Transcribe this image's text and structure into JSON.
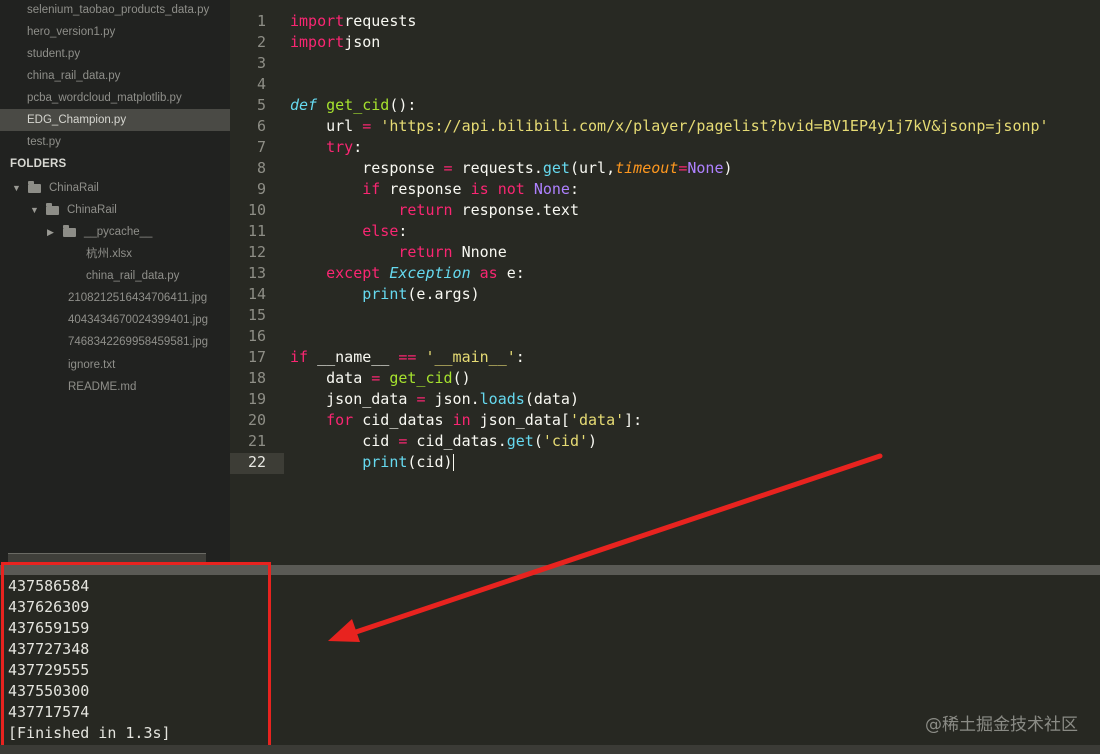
{
  "sidebar": {
    "open_files": [
      "selenium_taobao_products_data.py",
      "hero_version1.py",
      "student.py",
      "china_rail_data.py",
      "pcba_wordcloud_matplotlib.py",
      "EDG_Champion.py",
      "test.py"
    ],
    "active_open_file": "EDG_Champion.py",
    "folders_label": "FOLDERS",
    "tree": [
      {
        "label": "ChinaRail",
        "kind": "folder",
        "expanded": true
      },
      {
        "label": "ChinaRail",
        "kind": "folder",
        "expanded": true
      },
      {
        "label": "__pycache__",
        "kind": "folder",
        "expanded": false
      },
      {
        "label": "杭州.xlsx",
        "kind": "file"
      },
      {
        "label": "china_rail_data.py",
        "kind": "file"
      },
      {
        "label": "2108212516434706411.jpg",
        "kind": "file"
      },
      {
        "label": "4043434670024399401.jpg",
        "kind": "file"
      },
      {
        "label": "7468342269958459581.jpg",
        "kind": "file"
      },
      {
        "label": "ignore.txt",
        "kind": "file"
      },
      {
        "label": "README.md",
        "kind": "file"
      }
    ]
  },
  "editor": {
    "language": "python",
    "current_line": 22,
    "line_numbers": [
      "1",
      "2",
      "3",
      "4",
      "5",
      "6",
      "7",
      "8",
      "9",
      "10",
      "11",
      "12",
      "13",
      "14",
      "15",
      "16",
      "17",
      "18",
      "19",
      "20",
      "21",
      "22"
    ],
    "lines": [
      [
        [
          "kw",
          "import"
        ],
        [
          "",
          "requests"
        ]
      ],
      [
        [
          "kw",
          "import"
        ],
        [
          "",
          "json"
        ]
      ],
      [],
      [],
      [
        [
          "df",
          "def"
        ],
        [
          "",
          " "
        ],
        [
          "fn",
          "get_cid"
        ],
        [
          "",
          "():"
        ]
      ],
      [
        [
          "",
          "    url "
        ],
        [
          "kw",
          "="
        ],
        [
          "",
          " "
        ],
        [
          "st",
          "'https://api.bilibili.com/x/player/pagelist?bvid=BV1EP4y1j7kV&jsonp=jsonp'"
        ]
      ],
      [
        [
          "",
          "    "
        ],
        [
          "kw",
          "try"
        ],
        [
          "",
          ":"
        ]
      ],
      [
        [
          "",
          "        response "
        ],
        [
          "kw",
          "="
        ],
        [
          "",
          " requests."
        ],
        [
          "bi",
          "get"
        ],
        [
          "",
          "(url,"
        ],
        [
          "pa",
          "timeout"
        ],
        [
          "kw",
          "="
        ],
        [
          "cn",
          "None"
        ],
        [
          "",
          ")"
        ]
      ],
      [
        [
          "",
          "        "
        ],
        [
          "kw",
          "if"
        ],
        [
          "",
          " response "
        ],
        [
          "kw",
          "is"
        ],
        [
          "",
          " "
        ],
        [
          "kw",
          "not"
        ],
        [
          "",
          " "
        ],
        [
          "cn",
          "None"
        ],
        [
          "",
          ":"
        ]
      ],
      [
        [
          "",
          "            "
        ],
        [
          "kw",
          "return"
        ],
        [
          "",
          " response.text"
        ]
      ],
      [
        [
          "",
          "        "
        ],
        [
          "kw",
          "else"
        ],
        [
          "",
          ":"
        ]
      ],
      [
        [
          "",
          "            "
        ],
        [
          "kw",
          "return"
        ],
        [
          "",
          " Nnone"
        ]
      ],
      [
        [
          "",
          "    "
        ],
        [
          "kw",
          "except"
        ],
        [
          "",
          " "
        ],
        [
          "cls",
          "Exception"
        ],
        [
          "",
          " "
        ],
        [
          "kw",
          "as"
        ],
        [
          "",
          " e:"
        ]
      ],
      [
        [
          "",
          "        "
        ],
        [
          "bi",
          "print"
        ],
        [
          "",
          "(e.args)"
        ]
      ],
      [],
      [],
      [
        [
          "kw",
          "if"
        ],
        [
          "",
          " __name__ "
        ],
        [
          "kw",
          "=="
        ],
        [
          "",
          " "
        ],
        [
          "st",
          "'__main__'"
        ],
        [
          "",
          ":"
        ]
      ],
      [
        [
          "",
          "    data "
        ],
        [
          "kw",
          "="
        ],
        [
          "",
          " "
        ],
        [
          "fn",
          "get_cid"
        ],
        [
          "",
          "()"
        ]
      ],
      [
        [
          "",
          "    json_data "
        ],
        [
          "kw",
          "="
        ],
        [
          "",
          " json."
        ],
        [
          "bi",
          "loads"
        ],
        [
          "",
          "(data)"
        ]
      ],
      [
        [
          "",
          "    "
        ],
        [
          "kw",
          "for"
        ],
        [
          "",
          " cid_datas "
        ],
        [
          "kw",
          "in"
        ],
        [
          "",
          " json_data["
        ],
        [
          "st",
          "'data'"
        ],
        [
          "",
          "]:"
        ]
      ],
      [
        [
          "",
          "        cid "
        ],
        [
          "kw",
          "="
        ],
        [
          "",
          " cid_datas."
        ],
        [
          "bi",
          "get"
        ],
        [
          "",
          "("
        ],
        [
          "st",
          "'cid'"
        ],
        [
          "",
          ")"
        ]
      ],
      [
        [
          "",
          "        "
        ],
        [
          "bi",
          "print"
        ],
        [
          "",
          "(cid)"
        ]
      ]
    ]
  },
  "output": {
    "lines": [
      "437586584",
      "437626309",
      "437659159",
      "437727348",
      "437729555",
      "437550300",
      "437717574",
      "[Finished in 1.3s]"
    ]
  },
  "watermark": "@稀土掘金技术社区",
  "colors": {
    "highlight_box": "#e8231f",
    "arrow": "#e8231f",
    "keyword": "#f92672",
    "string": "#e6db74",
    "function": "#a6e22e",
    "builtin": "#66d9ef"
  }
}
